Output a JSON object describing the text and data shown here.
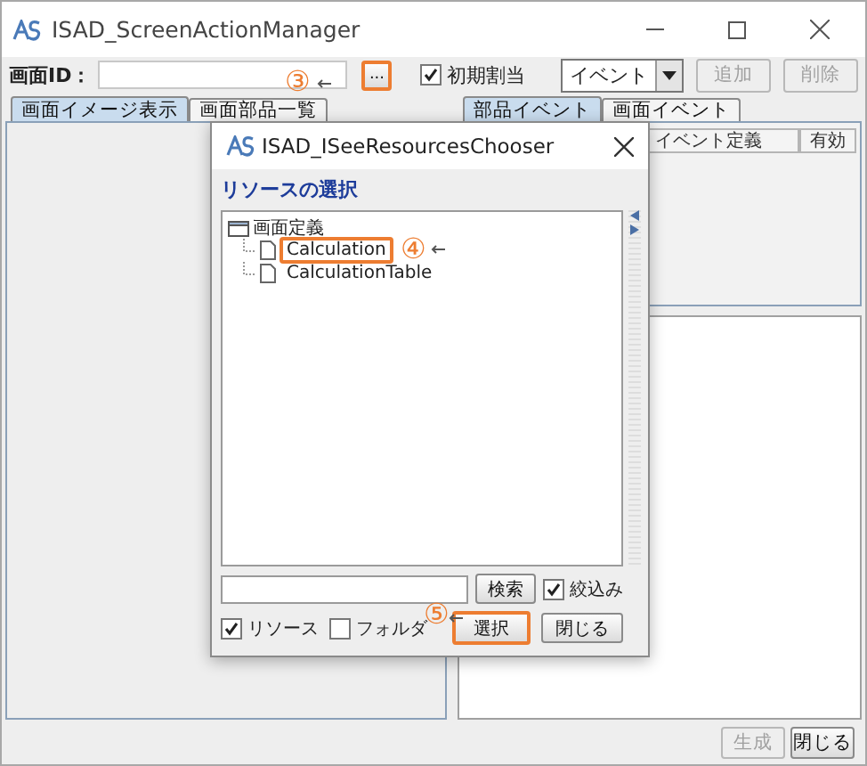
{
  "window": {
    "title": "ISAD_ScreenActionManager"
  },
  "toolbar": {
    "screen_id_label": "画面ID：",
    "browse_button": {
      "label": "...",
      "highlighted": true
    },
    "initial_checkbox": {
      "label": "初期割当",
      "checked": true
    },
    "event_dropdown": {
      "value": "イベント"
    },
    "buttons": [
      {
        "label": "追加",
        "disabled": true
      },
      {
        "label": "削除",
        "disabled": true
      }
    ]
  },
  "left_tabs": [
    {
      "label": "画面イメージ表示",
      "selected": true
    },
    {
      "label": "画面部品一覧",
      "selected": false
    }
  ],
  "right_tabs": [
    {
      "label": "部品イベント",
      "selected": true
    },
    {
      "label": "画面イベント",
      "selected": false
    }
  ],
  "table": {
    "columns": [
      "イベント定義",
      "有効"
    ]
  },
  "footer_buttons": [
    {
      "label": "生成",
      "disabled": true
    },
    {
      "label": "閉じる",
      "disabled": false
    }
  ],
  "dialog": {
    "title": "ISAD_ISeeResourcesChooser",
    "section_title": "リソースの選択",
    "tree": {
      "label": "画面定義",
      "expanded": true,
      "children": [
        {
          "label": "Calculation",
          "highlighted": true
        },
        {
          "label": "CalculationTable",
          "highlighted": false
        }
      ]
    },
    "search_button": "検索",
    "filter_checkbox": {
      "label": "絞込み",
      "checked": true
    },
    "options": [
      {
        "label": "リソース",
        "checked": true
      },
      {
        "label": "フォルダ",
        "checked": false
      }
    ],
    "buttons": [
      {
        "label": "選択",
        "highlighted": true
      },
      {
        "label": "閉じる",
        "highlighted": false
      }
    ]
  },
  "annotations": [
    {
      "number": "③"
    },
    {
      "number": "④"
    },
    {
      "number": "⑤"
    }
  ]
}
